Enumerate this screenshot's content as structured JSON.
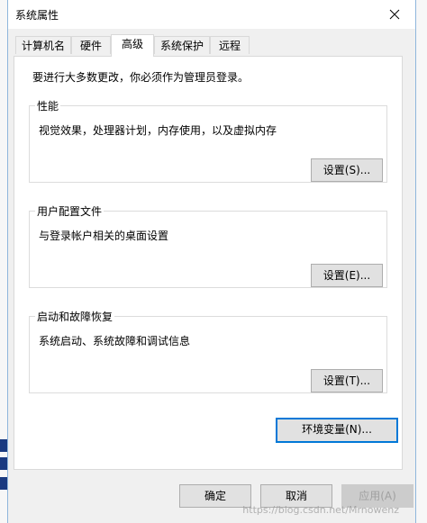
{
  "window": {
    "title": "系统属性"
  },
  "tabs": [
    {
      "label": "计算机名",
      "active": false
    },
    {
      "label": "硬件",
      "active": false
    },
    {
      "label": "高级",
      "active": true
    },
    {
      "label": "系统保护",
      "active": false
    },
    {
      "label": "远程",
      "active": false
    }
  ],
  "notice": "要进行大多数更改，你必须作为管理员登录。",
  "groups": {
    "performance": {
      "title": "性能",
      "description": "视觉效果，处理器计划，内存使用，以及虚拟内存",
      "button": "设置(S)..."
    },
    "user_profiles": {
      "title": "用户配置文件",
      "description": "与登录帐户相关的桌面设置",
      "button": "设置(E)..."
    },
    "startup_recovery": {
      "title": "启动和故障恢复",
      "description": "系统启动、系统故障和调试信息",
      "button": "设置(T)..."
    }
  },
  "env_button": "环境变量(N)...",
  "footer": {
    "ok": "确定",
    "cancel": "取消",
    "apply": "应用(A)"
  },
  "watermark": "https://blog.csdn.net/Mrnowenz",
  "colors": {
    "focus_border": "#0078d7",
    "dialog_bg": "#f0f0f0"
  }
}
